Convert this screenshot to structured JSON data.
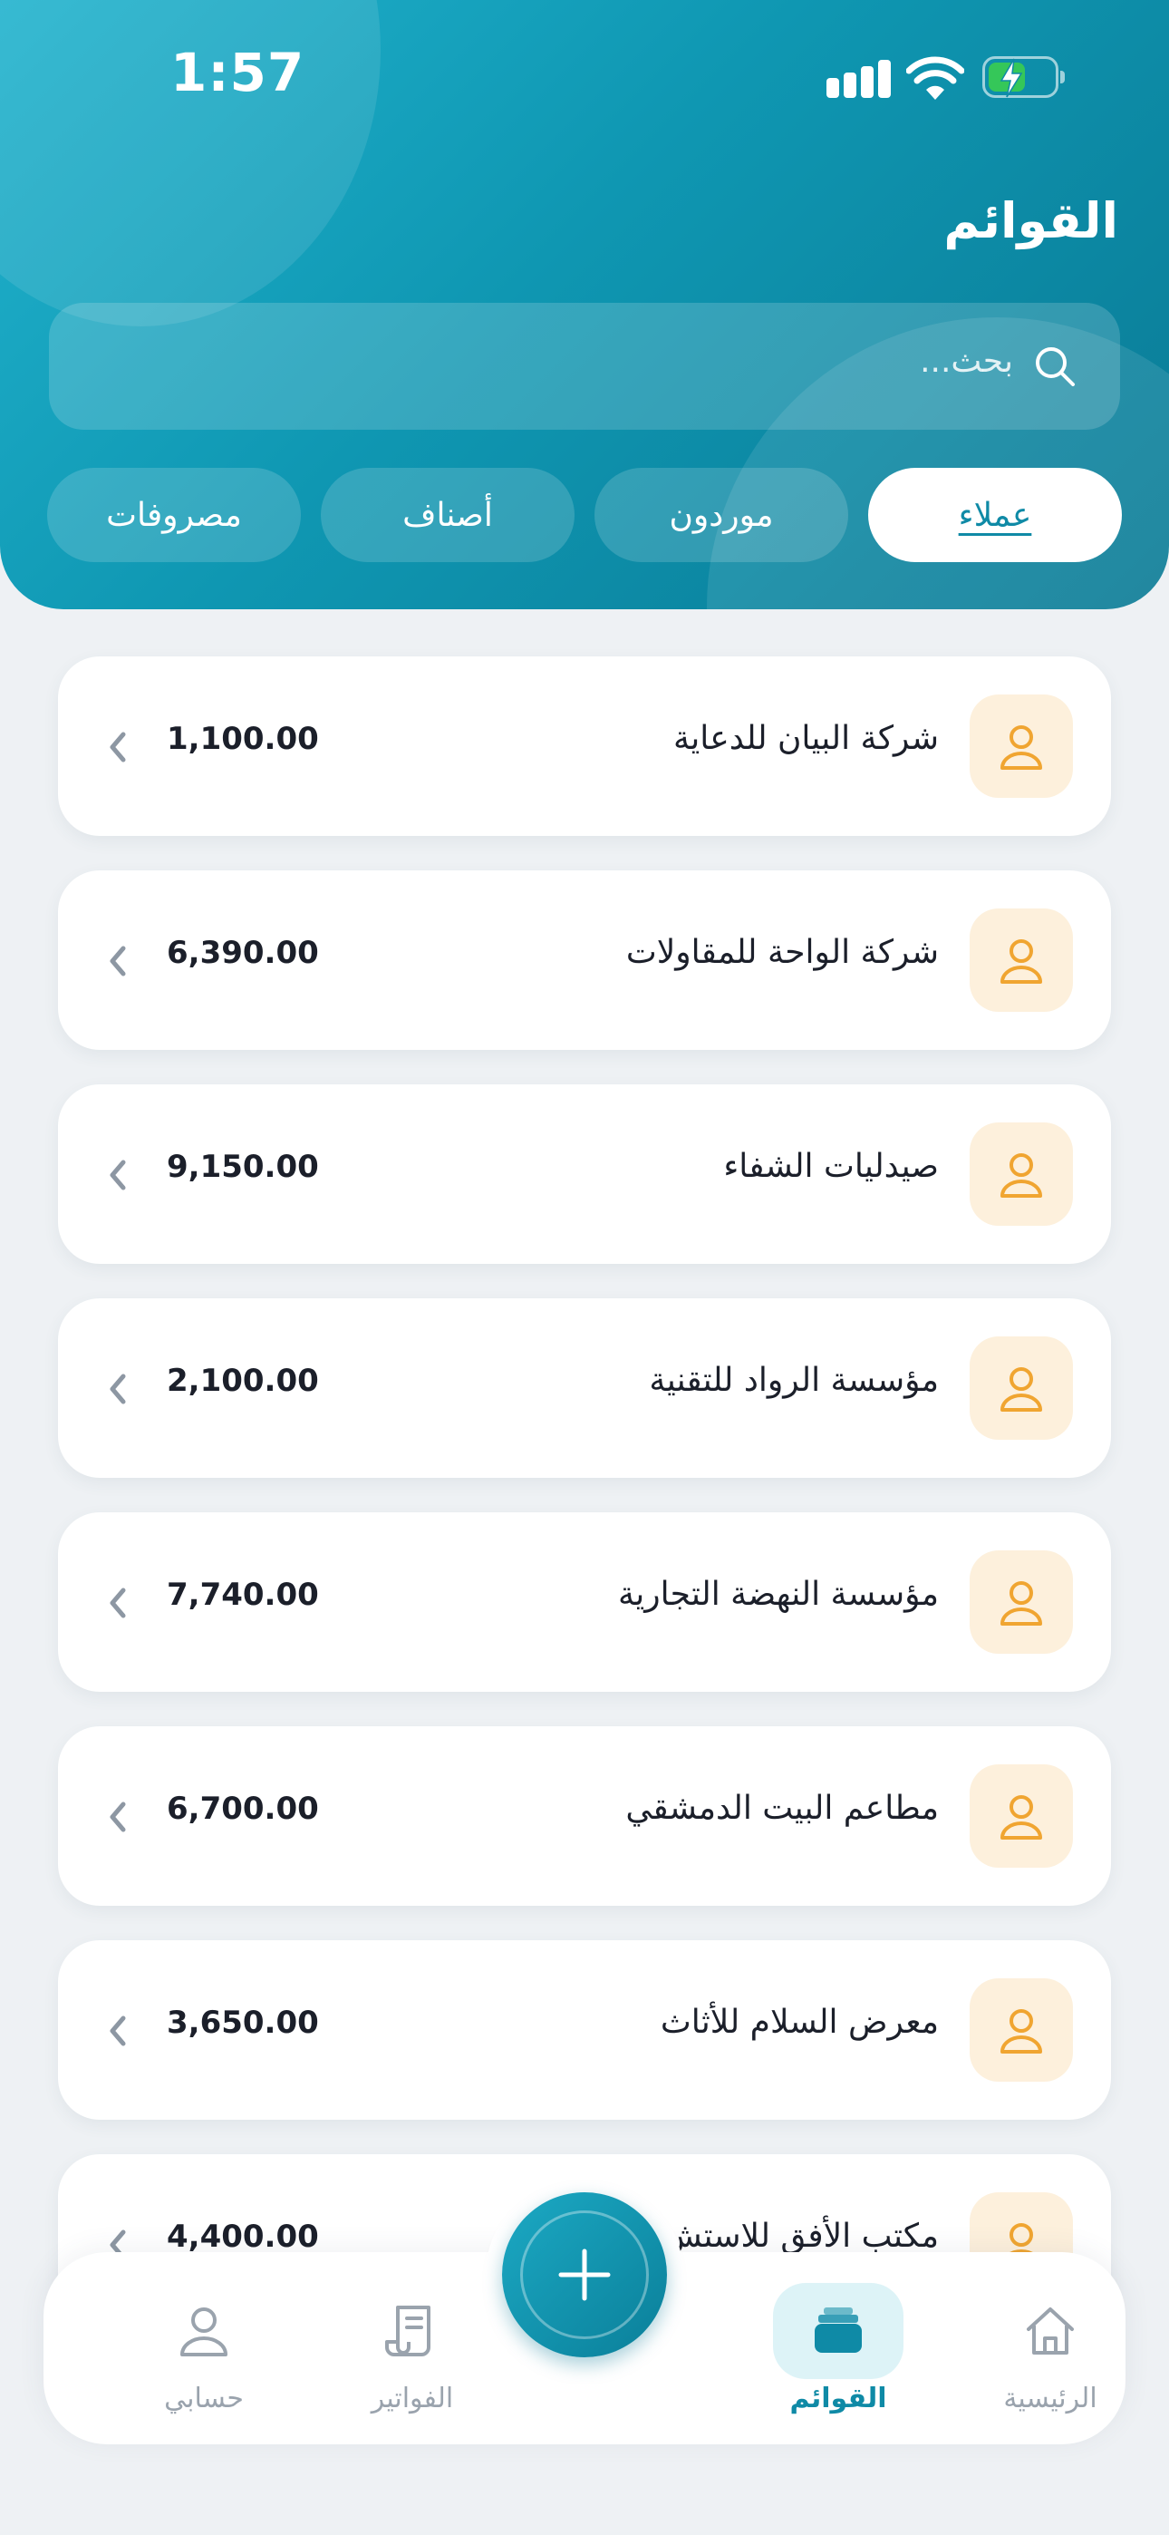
{
  "status_bar": {
    "time": "1:57"
  },
  "header": {
    "title": "القوائم"
  },
  "search": {
    "placeholder": "بحث..."
  },
  "tabs": [
    {
      "label": "عملاء",
      "active": true
    },
    {
      "label": "موردون",
      "active": false
    },
    {
      "label": "أصناف",
      "active": false
    },
    {
      "label": "مصروفات",
      "active": false
    }
  ],
  "customers": [
    {
      "name": "شركة البيان للدعاية",
      "amount": "1,100.00"
    },
    {
      "name": "شركة الواحة للمقاولات",
      "amount": "6,390.00"
    },
    {
      "name": "صيدليات الشفاء",
      "amount": "9,150.00"
    },
    {
      "name": "مؤسسة الرواد للتقنية",
      "amount": "2,100.00"
    },
    {
      "name": "مؤسسة النهضة التجارية",
      "amount": "7,740.00"
    },
    {
      "name": "مطاعم البيت الدمشقي",
      "amount": "6,700.00"
    },
    {
      "name": "معرض السلام للأثاث",
      "amount": "3,650.00"
    },
    {
      "name": "مكتب الأفق للاستش",
      "amount": "4,400.00"
    }
  ],
  "bottom_nav": {
    "home": "الرئيسية",
    "lists": "القوائم",
    "invoices": "الفواتير",
    "account": "حسابي"
  },
  "colors": {
    "primary": "#0f8aa6",
    "avatar_bg": "#fdf0dc",
    "avatar_icon": "#f0a531"
  }
}
